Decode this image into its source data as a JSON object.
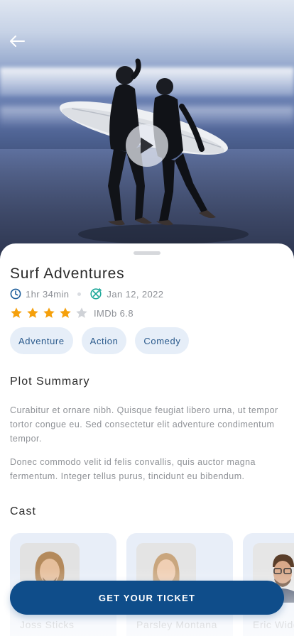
{
  "movie": {
    "title": "Surf Adventures",
    "duration": "1hr 34min",
    "release_date": "Jan 12, 2022",
    "rating_label": "IMDb 6.8",
    "stars_filled": 4,
    "stars_total": 5
  },
  "genres": [
    "Adventure",
    "Action",
    "Comedy"
  ],
  "plot": {
    "heading": "Plot Summary",
    "paragraphs": [
      "Curabitur et ornare nibh. Quisque feugiat libero urna, ut tempor tortor congue eu. Sed consectetur elit adventure condimentum tempor.",
      "Donec commodo velit id felis convallis, quis auctor magna fermentum. Integer tellus purus, tincidunt eu bibendum."
    ]
  },
  "cast": {
    "heading": "Cast",
    "members": [
      {
        "name": "Joss Sticks"
      },
      {
        "name": "Parsley Montana"
      },
      {
        "name": "Eric Widget"
      }
    ]
  },
  "cta": {
    "label": "GET YOUR TICKET"
  },
  "colors": {
    "primary": "#0f4d8a",
    "chip_bg": "#e6eef8",
    "chip_text": "#2a5a8c",
    "star_filled": "#f5a00b",
    "star_empty": "#cfd2d7",
    "clock_icon": "#1b5c9a",
    "calendar_icon": "#1ea89a"
  },
  "icons": {
    "back": "arrow-left-icon",
    "play": "play-icon",
    "duration": "clock-icon",
    "release": "calendar-icon",
    "rating": "star-icon"
  }
}
